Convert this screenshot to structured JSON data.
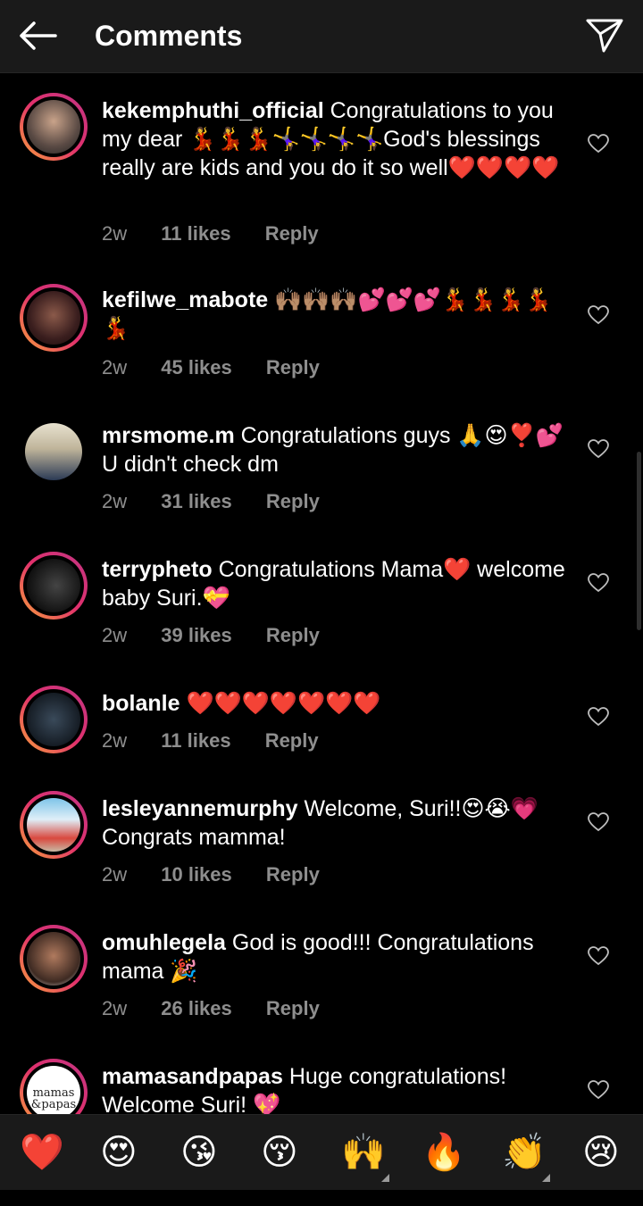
{
  "header": {
    "title": "Comments"
  },
  "comments": [
    {
      "username": "kekemphuthi_official",
      "text": "Congratulations to you my dear 💃💃💃🤸‍♀️🤸‍♀️🤸‍♀️🤸‍♀️God's blessings really are kids and you do it so well❤️❤️❤️❤️",
      "time": "2w",
      "likes": "11 likes",
      "reply": "Reply"
    },
    {
      "username": "kefilwe_mabote",
      "text": "🙌🏽🙌🏽🙌🏽💕💕💕💃💃💃💃💃",
      "time": "2w",
      "likes": "45 likes",
      "reply": "Reply"
    },
    {
      "username": "mrsmome.m",
      "text": "Congratulations guys 🙏😍❣️💕 U didn't check dm",
      "time": "2w",
      "likes": "31 likes",
      "reply": "Reply"
    },
    {
      "username": "terrypheto",
      "text": "Congratulations Mama❤️ welcome baby Suri.💝",
      "time": "2w",
      "likes": "39 likes",
      "reply": "Reply"
    },
    {
      "username": "bolanle",
      "text": "❤️❤️❤️❤️❤️❤️❤️",
      "time": "2w",
      "likes": "11 likes",
      "reply": "Reply"
    },
    {
      "username": "lesleyannemurphy",
      "text": "Welcome, Suri!!😍😭💗 Congrats mamma!",
      "time": "2w",
      "likes": "10 likes",
      "reply": "Reply"
    },
    {
      "username": "omuhlegela",
      "text": "God is good!!! Congratulations mama 🎉",
      "time": "2w",
      "likes": "26 likes",
      "reply": "Reply"
    },
    {
      "username": "mamasandpapas",
      "text": "Huge congratulations! Welcome Suri! 💖",
      "avatar_text": "mamas &papas"
    }
  ],
  "emoji_bar": [
    "❤️",
    "😍",
    "😘",
    "😚",
    "🙌",
    "🔥",
    "👏",
    "😢"
  ],
  "colors": {
    "background": "#000000",
    "bar": "#1a1a1a",
    "meta": "#8e8e8e"
  }
}
